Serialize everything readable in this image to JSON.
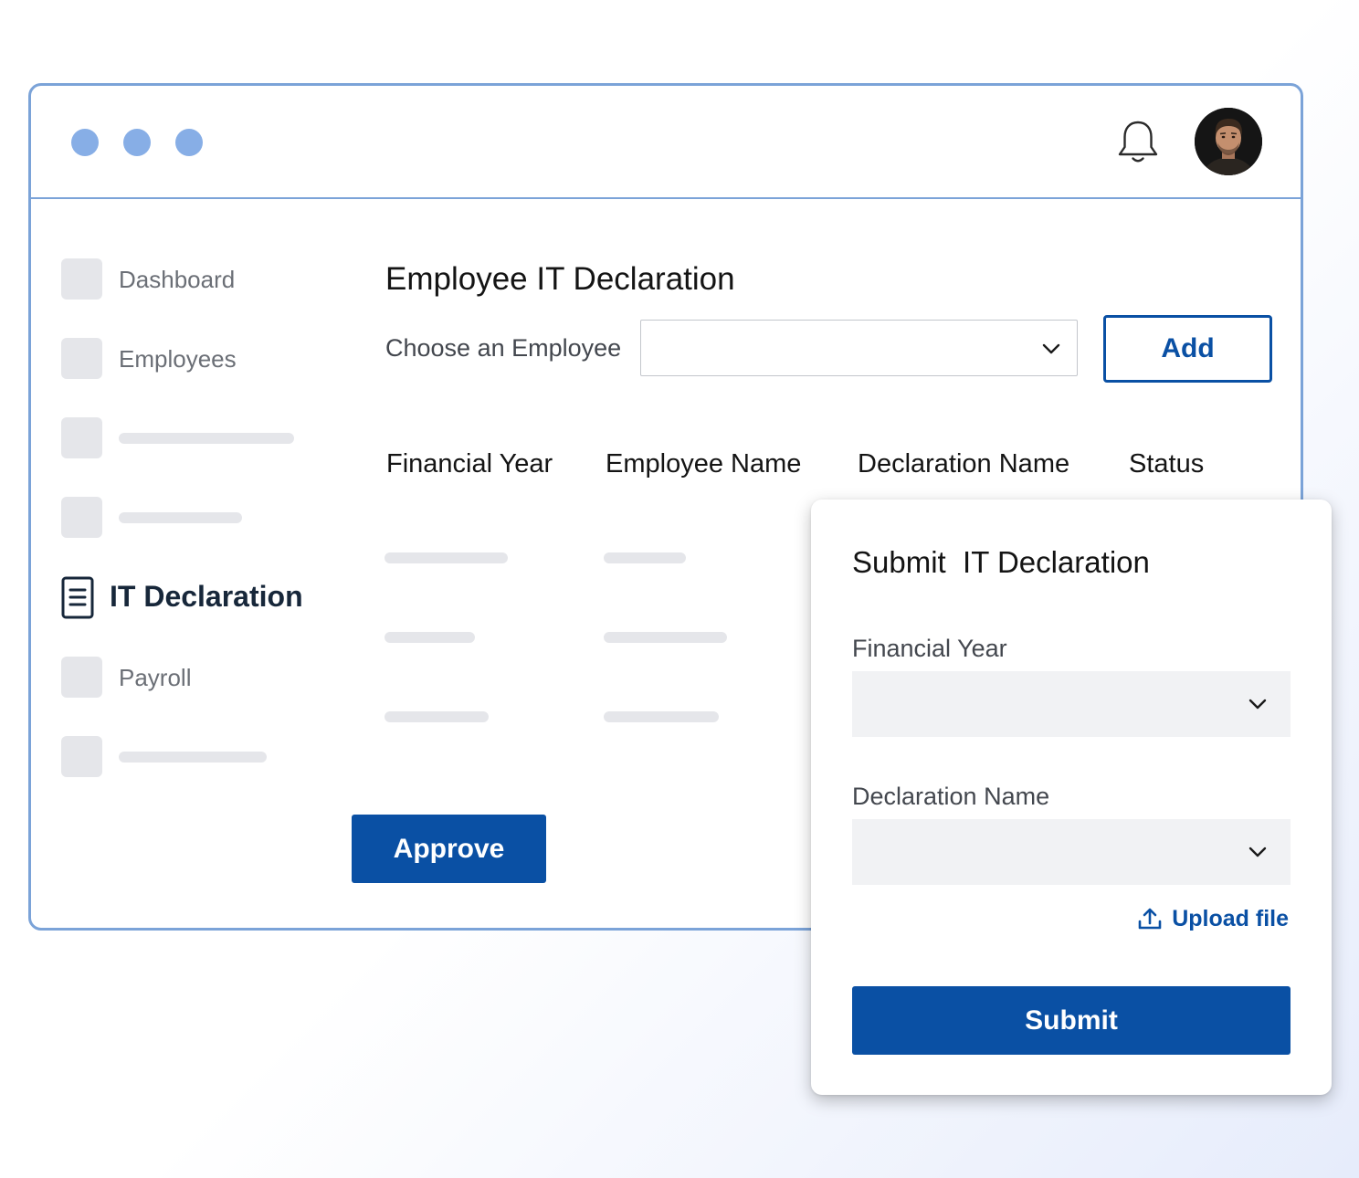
{
  "titlebar": {
    "window_controls": [
      "dot",
      "dot",
      "dot"
    ],
    "notification_icon": "bell-icon",
    "profile": {
      "avatar": "user-avatar"
    }
  },
  "sidebar": {
    "items": [
      {
        "label": "Dashboard",
        "icon": "placeholder-square"
      },
      {
        "label": "Employees",
        "icon": "placeholder-square"
      },
      {
        "label": "",
        "icon": "placeholder-square"
      },
      {
        "label": "",
        "icon": "placeholder-square"
      },
      {
        "label": "IT Declaration",
        "icon": "document-icon",
        "active": true
      },
      {
        "label": "Payroll",
        "icon": "placeholder-square"
      },
      {
        "label": "",
        "icon": "placeholder-square"
      }
    ]
  },
  "main": {
    "title": "Employee IT Declaration",
    "choose_label": "Choose an Employee",
    "employee_select_value": "",
    "add_label": "Add",
    "columns": [
      "Financial Year",
      "Employee Name",
      "Declaration Name",
      "Status"
    ],
    "approve_label": "Approve"
  },
  "modal": {
    "title": "Submit  IT Declaration",
    "financial_year_label": "Financial Year",
    "financial_year_value": "",
    "declaration_name_label": "Declaration Name",
    "declaration_name_value": "",
    "upload_label": "Upload file",
    "upload_icon": "upload-icon",
    "submit_label": "Submit"
  },
  "colors": {
    "primary": "#0a50a4",
    "window_border": "#7ba3d8",
    "window_dots": "#87aee6",
    "placeholder": "#e5e6ea",
    "active_text": "#17273a"
  }
}
